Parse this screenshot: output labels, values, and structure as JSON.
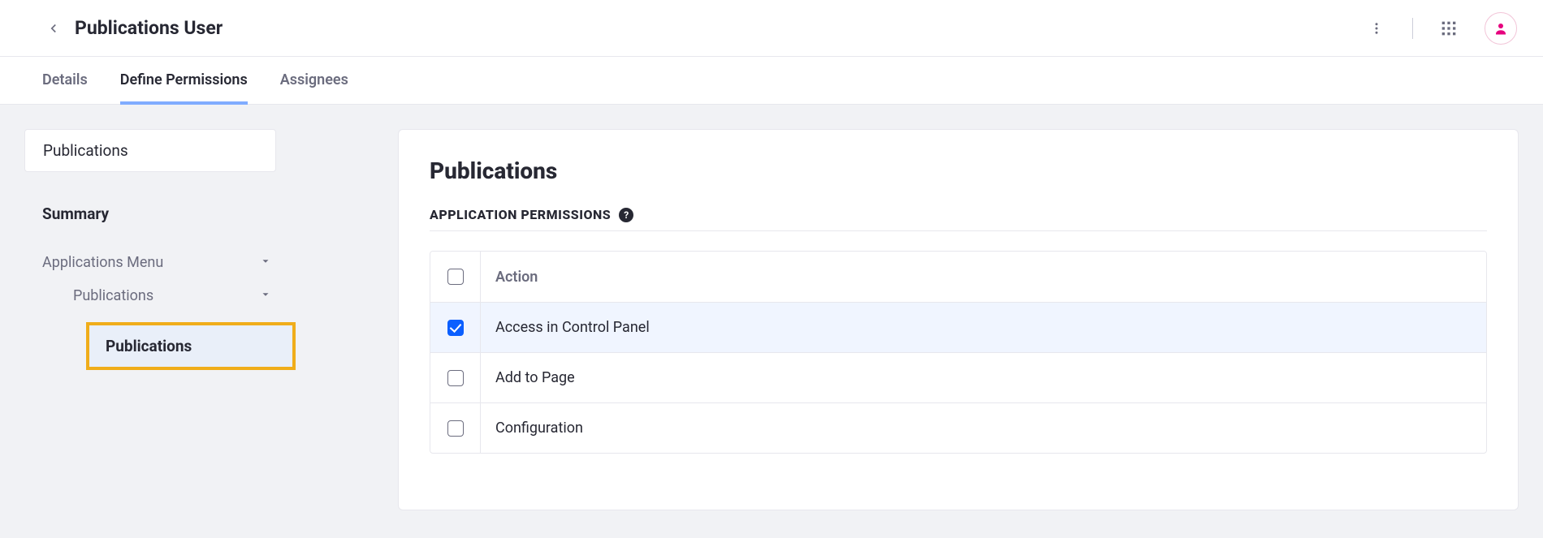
{
  "header": {
    "title": "Publications User"
  },
  "tabs": {
    "details": "Details",
    "define_permissions": "Define Permissions",
    "assignees": "Assignees",
    "active": "define_permissions"
  },
  "sidebar": {
    "search_value": "Publications",
    "summary_label": "Summary",
    "applications_menu_label": "Applications Menu",
    "publications_group_label": "Publications",
    "publications_leaf_label": "Publications"
  },
  "panel": {
    "title": "Publications",
    "section_label": "Application Permissions",
    "help_glyph": "?",
    "columns": {
      "action": "Action"
    },
    "rows": [
      {
        "label": "Access in Control Panel",
        "checked": true
      },
      {
        "label": "Add to Page",
        "checked": false
      },
      {
        "label": "Configuration",
        "checked": false
      }
    ]
  },
  "icons": {
    "back": "chevron-left",
    "kebab": "vertical-dots",
    "apps": "grid-3x3",
    "user": "user"
  }
}
